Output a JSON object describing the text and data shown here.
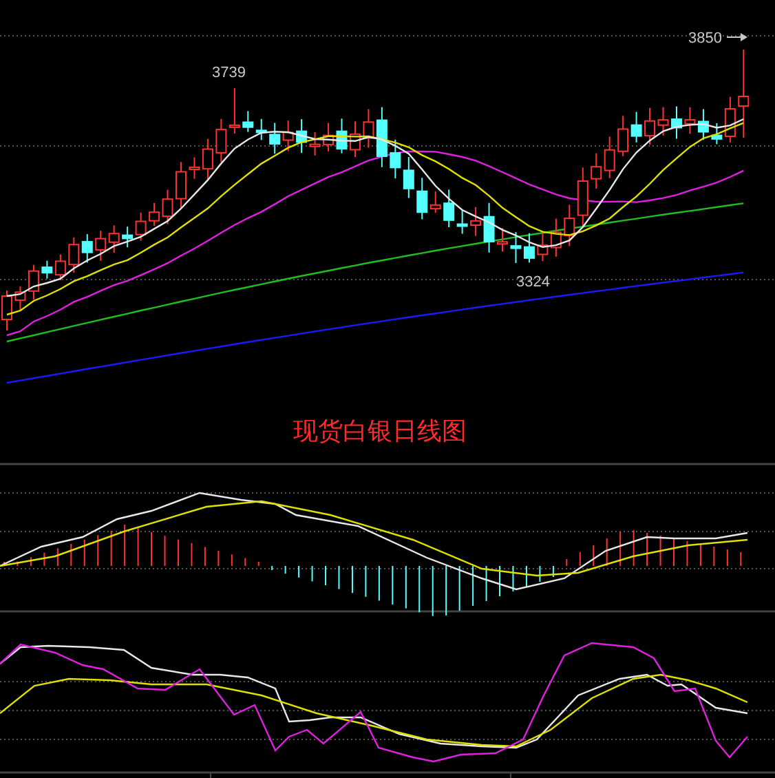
{
  "chart": {
    "high_label": "3850",
    "peak_label": "3739",
    "low_label": "3324",
    "title": "现货白银日线图"
  }
}
